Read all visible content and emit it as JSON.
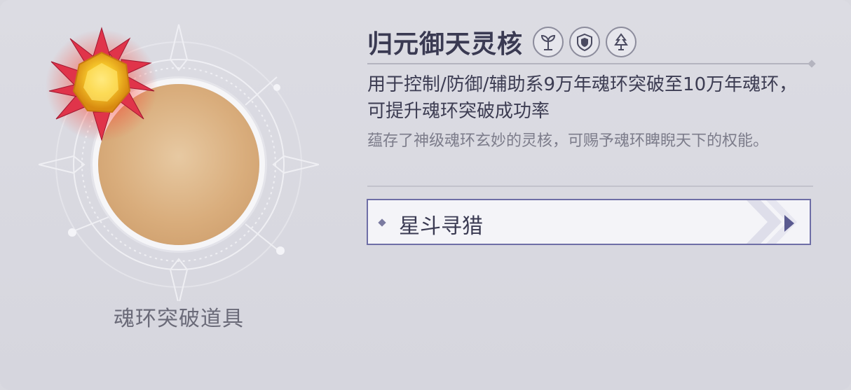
{
  "item": {
    "name": "归元御天灵核",
    "category": "魂环突破道具",
    "description": "用于控制/防御/辅助系9万年魂环突破至10万年魂环，可提升魂环突破成功率",
    "lore": "蕴存了神级魂环玄妙的灵核，可赐予魂环睥睨天下的权能。",
    "badges": [
      {
        "icon": "control-sprout-icon"
      },
      {
        "icon": "defense-shield-icon"
      },
      {
        "icon": "support-tree-icon"
      }
    ]
  },
  "source": {
    "label": "星斗寻猎",
    "icon": "play-arrow-icon"
  },
  "colors": {
    "background": "#d9d9e0",
    "title_text": "#3a3a52",
    "secondary_text": "#7c7c8a",
    "button_border": "#6e6ea6",
    "gem_circle": "#d9ad7c"
  }
}
